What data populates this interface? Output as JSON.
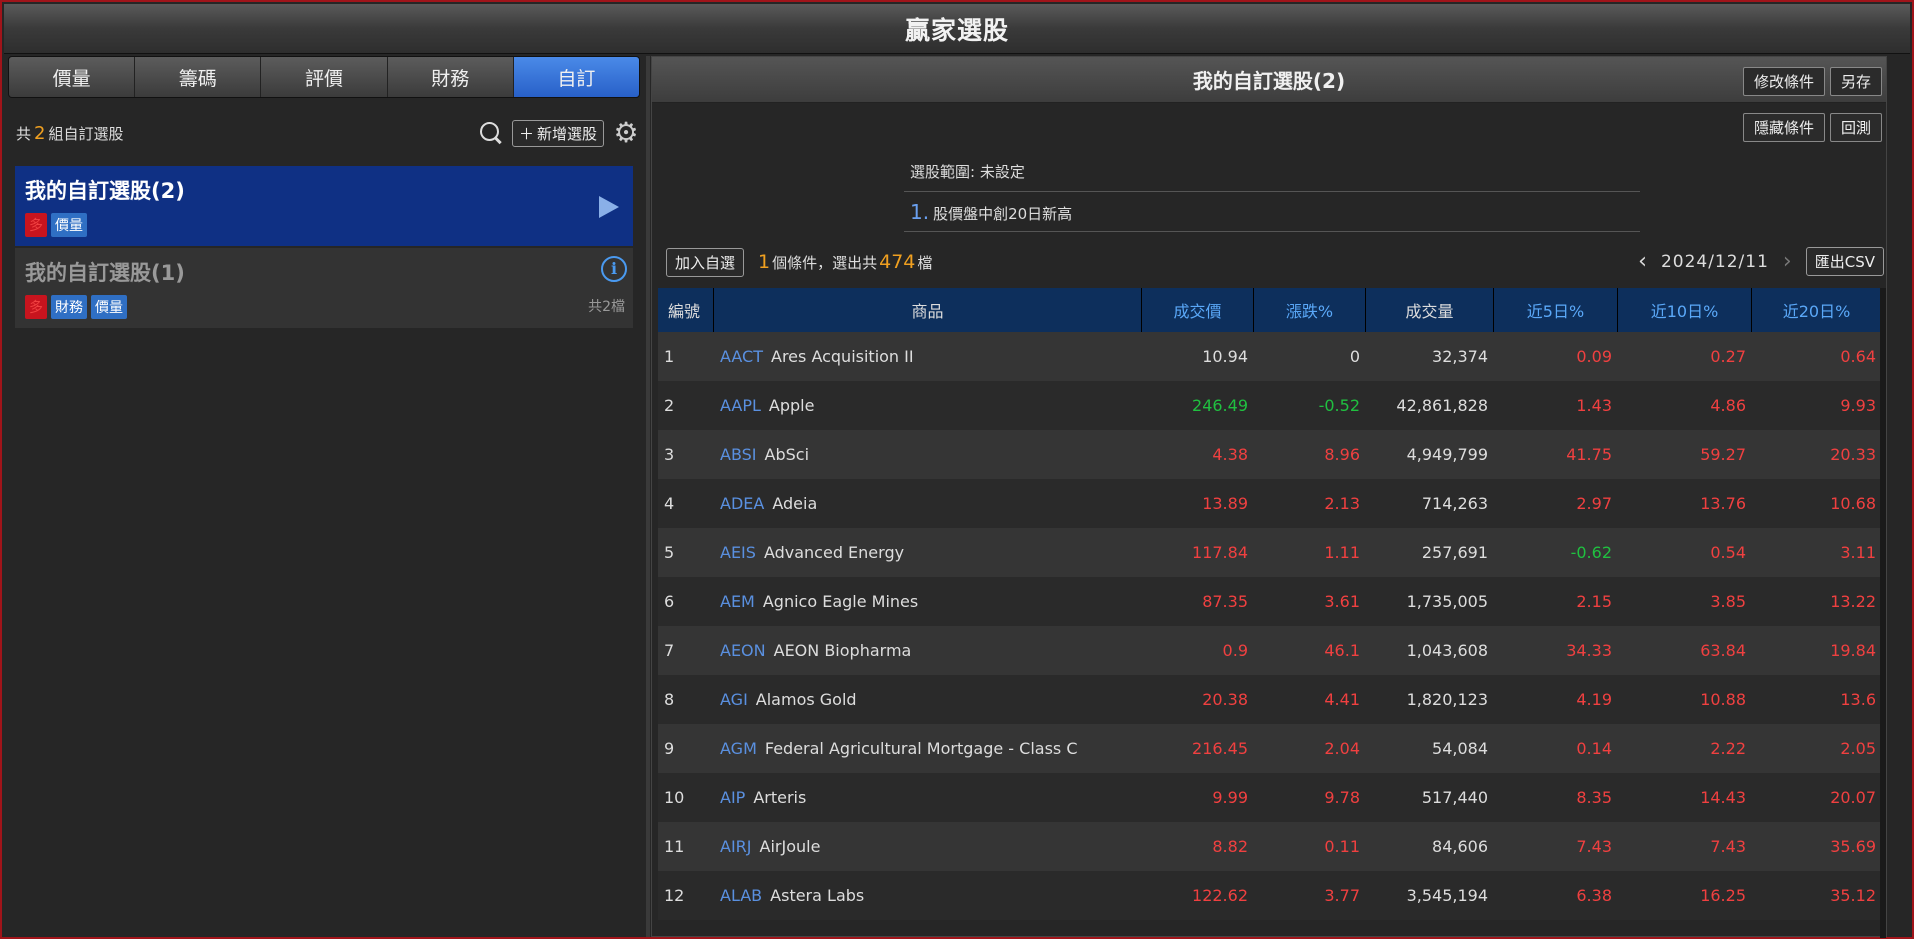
{
  "window": {
    "title": "贏家選股"
  },
  "tabs": [
    {
      "label": "價量",
      "active": false
    },
    {
      "label": "籌碼",
      "active": false
    },
    {
      "label": "評價",
      "active": false
    },
    {
      "label": "財務",
      "active": false
    },
    {
      "label": "自訂",
      "active": true
    }
  ],
  "left": {
    "count_prefix": "共",
    "count_num": "2",
    "count_suffix": "組自訂選股",
    "add_label": "新增選股",
    "groups": [
      {
        "name": "我的自訂選股(2)",
        "tags": [
          "多",
          "價量"
        ],
        "selected": true
      },
      {
        "name": "我的自訂選股(1)",
        "tags": [
          "多",
          "財務",
          "價量"
        ],
        "total": "共2檔",
        "selected": false
      }
    ]
  },
  "right": {
    "title": "我的自訂選股(2)",
    "btn_modify": "修改條件",
    "btn_save_as": "另存",
    "btn_hide": "隱藏條件",
    "btn_backtest": "回測",
    "range_label": "選股範圍: 未設定",
    "condition_index": "1.",
    "condition_text": "股價盤中創20日新高",
    "add_watch": "加入自選",
    "result_cond_count": "1",
    "result_mid": "個條件，選出共",
    "result_count": "474",
    "result_suffix": "檔",
    "date": "2024/12/11",
    "export_csv": "匯出CSV"
  },
  "table": {
    "headers": [
      "編號",
      "商品",
      "成交價",
      "漲跌%",
      "成交量",
      "近5日%",
      "近10日%",
      "近20日%"
    ],
    "rows": [
      {
        "no": "1",
        "sym": "AACT",
        "name": "Ares Acquisition II",
        "price": "10.94",
        "chg": "0",
        "vol": "32,374",
        "d5": "0.09",
        "d10": "0.27",
        "d20": "0.64",
        "pc": "white",
        "cc": "white",
        "c5": "red",
        "c10": "red",
        "c20": "red"
      },
      {
        "no": "2",
        "sym": "AAPL",
        "name": "Apple",
        "price": "246.49",
        "chg": "-0.52",
        "vol": "42,861,828",
        "d5": "1.43",
        "d10": "4.86",
        "d20": "9.93",
        "pc": "green",
        "cc": "green",
        "c5": "red",
        "c10": "red",
        "c20": "red"
      },
      {
        "no": "3",
        "sym": "ABSI",
        "name": "AbSci",
        "price": "4.38",
        "chg": "8.96",
        "vol": "4,949,799",
        "d5": "41.75",
        "d10": "59.27",
        "d20": "20.33",
        "pc": "red",
        "cc": "red",
        "c5": "red",
        "c10": "red",
        "c20": "red"
      },
      {
        "no": "4",
        "sym": "ADEA",
        "name": "Adeia",
        "price": "13.89",
        "chg": "2.13",
        "vol": "714,263",
        "d5": "2.97",
        "d10": "13.76",
        "d20": "10.68",
        "pc": "red",
        "cc": "red",
        "c5": "red",
        "c10": "red",
        "c20": "red"
      },
      {
        "no": "5",
        "sym": "AEIS",
        "name": "Advanced Energy",
        "price": "117.84",
        "chg": "1.11",
        "vol": "257,691",
        "d5": "-0.62",
        "d10": "0.54",
        "d20": "3.11",
        "pc": "red",
        "cc": "red",
        "c5": "green",
        "c10": "red",
        "c20": "red"
      },
      {
        "no": "6",
        "sym": "AEM",
        "name": "Agnico Eagle Mines",
        "price": "87.35",
        "chg": "3.61",
        "vol": "1,735,005",
        "d5": "2.15",
        "d10": "3.85",
        "d20": "13.22",
        "pc": "red",
        "cc": "red",
        "c5": "red",
        "c10": "red",
        "c20": "red"
      },
      {
        "no": "7",
        "sym": "AEON",
        "name": "AEON Biopharma",
        "price": "0.9",
        "chg": "46.1",
        "vol": "1,043,608",
        "d5": "34.33",
        "d10": "63.84",
        "d20": "19.84",
        "pc": "red",
        "cc": "red",
        "c5": "red",
        "c10": "red",
        "c20": "red"
      },
      {
        "no": "8",
        "sym": "AGI",
        "name": "Alamos Gold",
        "price": "20.38",
        "chg": "4.41",
        "vol": "1,820,123",
        "d5": "4.19",
        "d10": "10.88",
        "d20": "13.6",
        "pc": "red",
        "cc": "red",
        "c5": "red",
        "c10": "red",
        "c20": "red"
      },
      {
        "no": "9",
        "sym": "AGM",
        "name": "Federal Agricultural Mortgage - Class C",
        "price": "216.45",
        "chg": "2.04",
        "vol": "54,084",
        "d5": "0.14",
        "d10": "2.22",
        "d20": "2.05",
        "pc": "red",
        "cc": "red",
        "c5": "red",
        "c10": "red",
        "c20": "red"
      },
      {
        "no": "10",
        "sym": "AIP",
        "name": "Arteris",
        "price": "9.99",
        "chg": "9.78",
        "vol": "517,440",
        "d5": "8.35",
        "d10": "14.43",
        "d20": "20.07",
        "pc": "red",
        "cc": "red",
        "c5": "red",
        "c10": "red",
        "c20": "red"
      },
      {
        "no": "11",
        "sym": "AIRJ",
        "name": "AirJoule",
        "price": "8.82",
        "chg": "0.11",
        "vol": "84,606",
        "d5": "7.43",
        "d10": "7.43",
        "d20": "35.69",
        "pc": "red",
        "cc": "red",
        "c5": "red",
        "c10": "red",
        "c20": "red"
      },
      {
        "no": "12",
        "sym": "ALAB",
        "name": "Astera Labs",
        "price": "122.62",
        "chg": "3.77",
        "vol": "3,545,194",
        "d5": "6.38",
        "d10": "16.25",
        "d20": "35.12",
        "pc": "red",
        "cc": "red",
        "c5": "red",
        "c10": "red",
        "c20": "red"
      }
    ]
  }
}
